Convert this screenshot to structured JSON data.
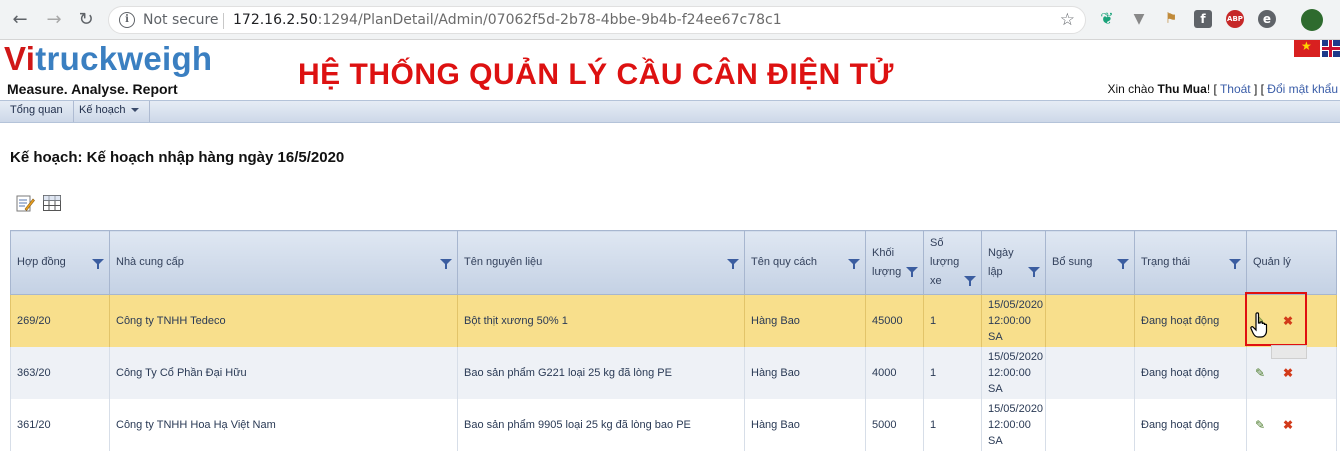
{
  "browser": {
    "security": "Not secure",
    "url_host": "172.16.2.50",
    "url_rest": ":1294/PlanDetail/Admin/07062f5d-2b78-4bbe-9b4b-f24ee67c78c1"
  },
  "header": {
    "logo_vi": "Vi",
    "logo_rest": "truckweigh",
    "tagline": "Measure. Analyse. Report",
    "system_title": "HỆ THỐNG QUẢN LÝ CẦU CÂN ĐIỆN TỬ",
    "greeting_prefix": "Xin chào ",
    "user": "Thu Mua",
    "greeting_suffix": "! [ ",
    "logout": "Thoát",
    "mid": " ] [ ",
    "change_password": "Đổi mật khẩu"
  },
  "menu": {
    "overview": "Tổng quan",
    "plan": "Kế hoạch"
  },
  "page": {
    "title": "Kế hoạch: Kế hoạch nhập hàng ngày 16/5/2020"
  },
  "table": {
    "headers": [
      "Hợp đồng",
      "Nhà cung cấp",
      "Tên nguyên liệu",
      "Tên quy cách",
      "Khối lượng",
      "Số lượng xe",
      "Ngày lập",
      "Bổ sung",
      "Trạng thái",
      "Quản lý"
    ],
    "rows": [
      {
        "contract": "269/20",
        "supplier": "Công ty TNHH Tedeco",
        "material": "Bột thịt xương 50% 1",
        "spec": "Hàng Bao",
        "weight": "45000",
        "trucks": "1",
        "date1": "15/05/2020",
        "date2": "12:00:00",
        "date3": "SA",
        "extra": "",
        "status": "Đang hoạt động"
      },
      {
        "contract": "363/20",
        "supplier": "Công Ty Cổ Phần Đại Hữu",
        "material": "Bao sản phẩm G221 loại 25 kg đã lòng PE",
        "spec": "Hàng Bao",
        "weight": "4000",
        "trucks": "1",
        "date1": "15/05/2020",
        "date2": "12:00:00",
        "date3": "SA",
        "extra": "",
        "status": "Đang hoạt động"
      },
      {
        "contract": "361/20",
        "supplier": "Công ty TNHH Hoa Hạ Việt Nam",
        "material": "Bao sản phẩm 9905 loại 25 kg đã lòng bao PE",
        "spec": "Hàng Bao",
        "weight": "5000",
        "trucks": "1",
        "date1": "15/05/2020",
        "date2": "12:00:00",
        "date3": "SA",
        "extra": "",
        "status": "Đang hoạt động"
      }
    ]
  },
  "colors": {
    "brand_red": "#d01717",
    "brand_blue": "#3a7fc1",
    "selected_row": "#f8df8c",
    "highlight_box": "#e01010"
  }
}
